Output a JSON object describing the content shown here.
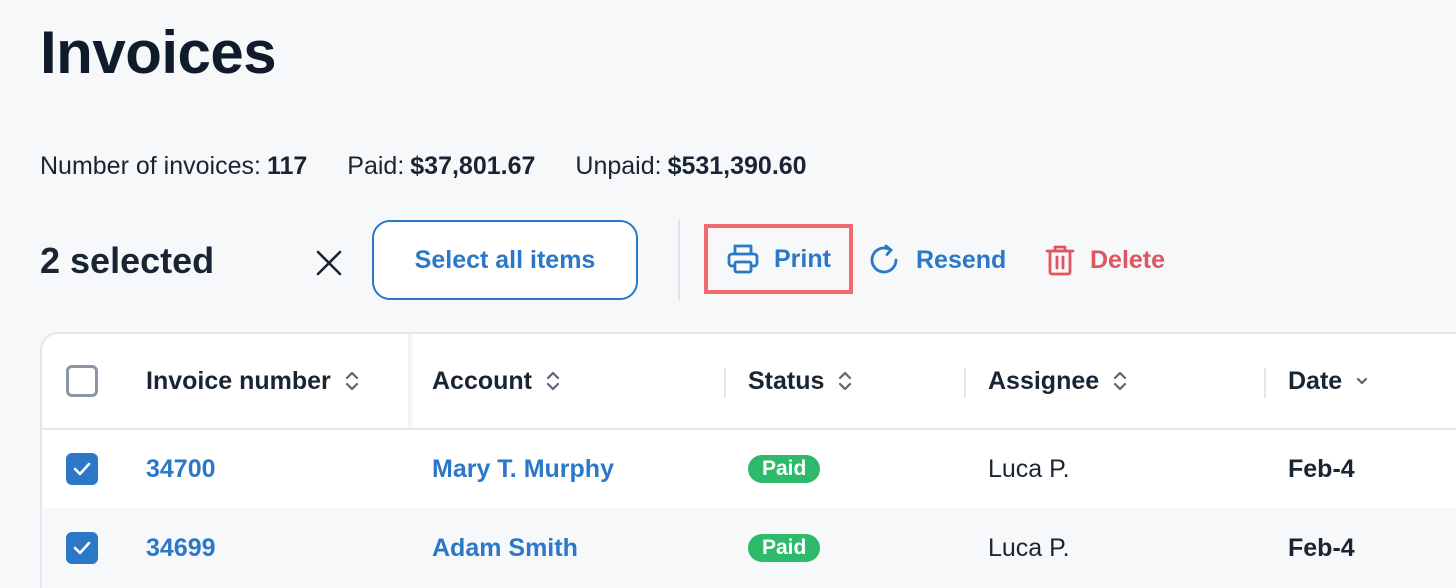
{
  "page": {
    "title": "Invoices"
  },
  "stats": [
    {
      "label": "Number of invoices:",
      "value": "117"
    },
    {
      "label": "Paid:",
      "value": "$37,801.67"
    },
    {
      "label": "Unpaid:",
      "value": "$531,390.60"
    }
  ],
  "bulk": {
    "selected_text": "2 selected",
    "select_all_label": "Select all items",
    "print_label": "Print",
    "resend_label": "Resend",
    "delete_label": "Delete"
  },
  "table": {
    "headers": {
      "invoice_number": "Invoice number",
      "account": "Account",
      "status": "Status",
      "assignee": "Assignee",
      "date": "Date"
    },
    "rows": [
      {
        "checked": true,
        "invoice_number": "34700",
        "account": "Mary T. Murphy",
        "status": "Paid",
        "assignee": "Luca P.",
        "date": "Feb-4"
      },
      {
        "checked": true,
        "invoice_number": "34699",
        "account": "Adam Smith",
        "status": "Paid",
        "assignee": "Luca P.",
        "date": "Feb-4"
      }
    ]
  },
  "colors": {
    "accent": "#2a78c7",
    "danger": "#e05561",
    "success": "#2dbb6b",
    "highlight": "#f2696e"
  }
}
